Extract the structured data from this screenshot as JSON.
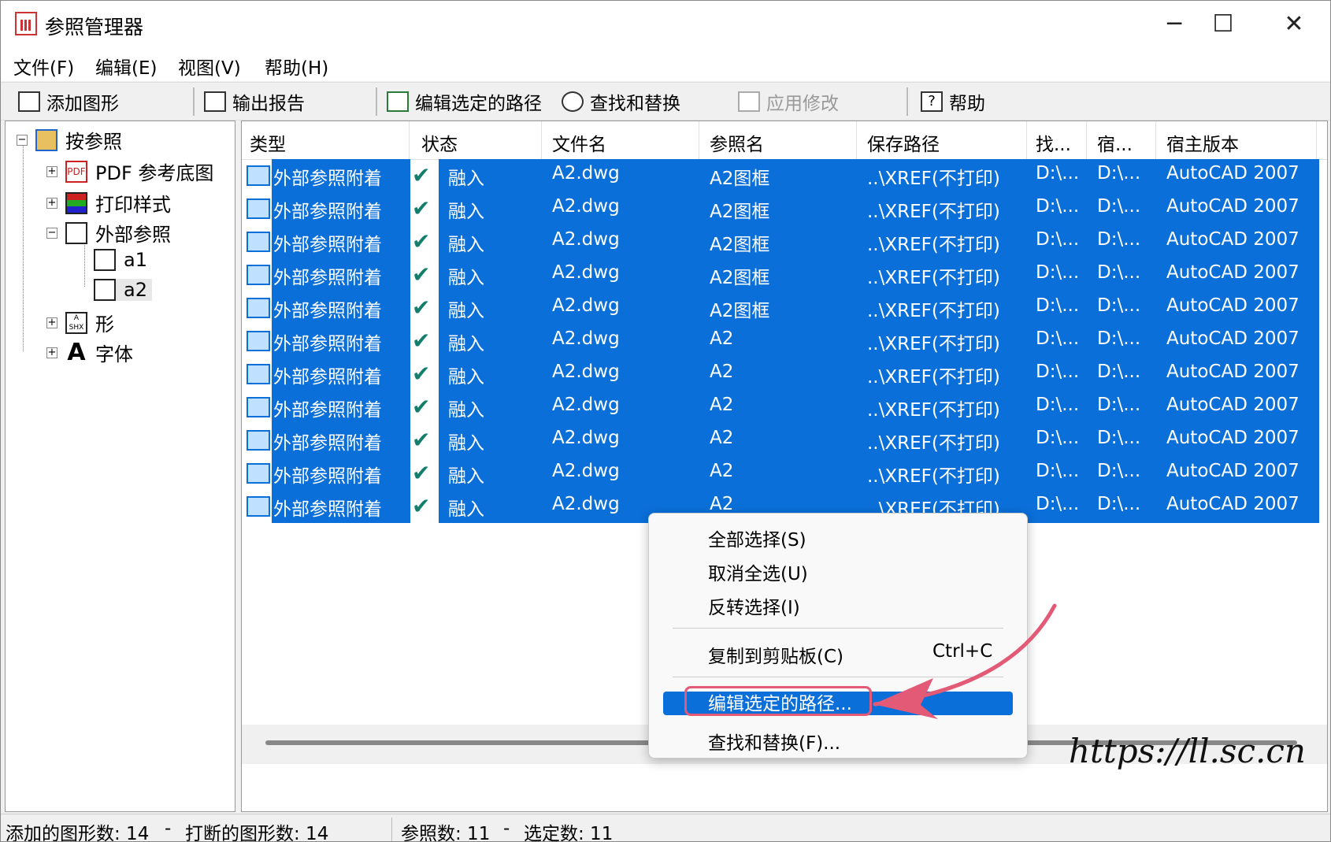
{
  "window": {
    "title": "参照管理器",
    "controls": {
      "minimize": "─",
      "maximize": "☐",
      "close": "✕"
    }
  },
  "menubar": {
    "items": [
      "文件(F)",
      "编辑(E)",
      "视图(V)",
      "帮助(H)"
    ]
  },
  "toolbar": {
    "add_drawing": "添加图形",
    "export_report": "输出报告",
    "edit_selected_path": "编辑选定的路径",
    "find_replace": "查找和替换",
    "apply_changes": "应用修改",
    "help": "帮助"
  },
  "tree": {
    "root": "按参照",
    "pdf_underlay": "PDF 参考底图",
    "plot_styles": "打印样式",
    "xrefs": "外部参照",
    "xref_a1": "a1",
    "xref_a2": "a2",
    "shapes": "形",
    "fonts": "字体",
    "pdf_icon_text": "PDF",
    "shx_icon_text": "A SHX",
    "font_icon_text": "A"
  },
  "table": {
    "headers": [
      "类型",
      "状态",
      "文件名",
      "参照名",
      "保存路径",
      "找...",
      "宿...",
      "宿主版本"
    ],
    "rows": [
      {
        "type": "外部参照附着",
        "status": "融入",
        "file": "A2.dwg",
        "ref": "A2图框",
        "path": "..\\XREF(不打印)",
        "found": "D:\\...",
        "host": "D:\\...",
        "version": "AutoCAD 2007"
      },
      {
        "type": "外部参照附着",
        "status": "融入",
        "file": "A2.dwg",
        "ref": "A2图框",
        "path": "..\\XREF(不打印)",
        "found": "D:\\...",
        "host": "D:\\...",
        "version": "AutoCAD 2007"
      },
      {
        "type": "外部参照附着",
        "status": "融入",
        "file": "A2.dwg",
        "ref": "A2图框",
        "path": "..\\XREF(不打印)",
        "found": "D:\\...",
        "host": "D:\\...",
        "version": "AutoCAD 2007"
      },
      {
        "type": "外部参照附着",
        "status": "融入",
        "file": "A2.dwg",
        "ref": "A2图框",
        "path": "..\\XREF(不打印)",
        "found": "D:\\...",
        "host": "D:\\...",
        "version": "AutoCAD 2007"
      },
      {
        "type": "外部参照附着",
        "status": "融入",
        "file": "A2.dwg",
        "ref": "A2图框",
        "path": "..\\XREF(不打印)",
        "found": "D:\\...",
        "host": "D:\\...",
        "version": "AutoCAD 2007"
      },
      {
        "type": "外部参照附着",
        "status": "融入",
        "file": "A2.dwg",
        "ref": "A2",
        "path": "..\\XREF(不打印)",
        "found": "D:\\...",
        "host": "D:\\...",
        "version": "AutoCAD 2007"
      },
      {
        "type": "外部参照附着",
        "status": "融入",
        "file": "A2.dwg",
        "ref": "A2",
        "path": "..\\XREF(不打印)",
        "found": "D:\\...",
        "host": "D:\\...",
        "version": "AutoCAD 2007"
      },
      {
        "type": "外部参照附着",
        "status": "融入",
        "file": "A2.dwg",
        "ref": "A2",
        "path": "..\\XREF(不打印)",
        "found": "D:\\...",
        "host": "D:\\...",
        "version": "AutoCAD 2007"
      },
      {
        "type": "外部参照附着",
        "status": "融入",
        "file": "A2.dwg",
        "ref": "A2",
        "path": "..\\XREF(不打印)",
        "found": "D:\\...",
        "host": "D:\\...",
        "version": "AutoCAD 2007"
      },
      {
        "type": "外部参照附着",
        "status": "融入",
        "file": "A2.dwg",
        "ref": "A2",
        "path": "..\\XREF(不打印)",
        "found": "D:\\...",
        "host": "D:\\...",
        "version": "AutoCAD 2007"
      },
      {
        "type": "外部参照附着",
        "status": "融入",
        "file": "A2.dwg",
        "ref": "A2",
        "path": "..\\XREF(不打印)",
        "found": "D:\\...",
        "host": "D:\\...",
        "version": "AutoCAD 2007"
      }
    ]
  },
  "context_menu": {
    "select_all": "全部选择(S)",
    "deselect_all": "取消全选(U)",
    "invert_selection": "反转选择(I)",
    "copy_clipboard": "复制到剪贴板(C)",
    "copy_shortcut": "Ctrl+C",
    "edit_selected_path": "编辑选定的路径...",
    "find_replace": "查找和替换(F)..."
  },
  "status": {
    "added_count": "添加的图形数: 14",
    "sep1": "-",
    "broken_count": "打断的图形数: 14",
    "ref_count": "参照数: 11",
    "sep2": "-",
    "selected_count": "选定数: 11"
  },
  "watermark": "https://ll.sc.cn",
  "colors": {
    "selection": "#0a6fd8",
    "check": "#127e6b",
    "annotation": "#e35a77"
  }
}
